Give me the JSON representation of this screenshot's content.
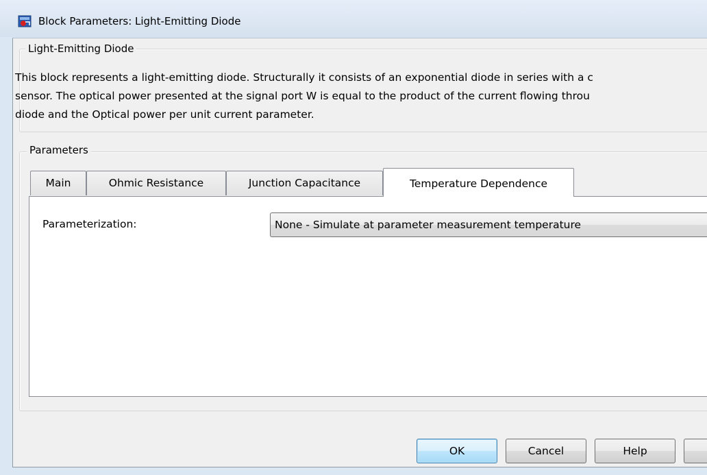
{
  "window": {
    "title": "Block Parameters: Light-Emitting Diode"
  },
  "description": {
    "group_label": "Light-Emitting Diode",
    "lines": [
      "This block represents a light-emitting diode. Structurally it consists of an exponential diode in series with a c",
      "sensor. The optical power presented at the signal port W is equal to the product of the current flowing throu",
      "diode and the Optical power per unit current parameter."
    ]
  },
  "parameters": {
    "group_label": "Parameters",
    "tabs": [
      {
        "label": "Main",
        "active": false
      },
      {
        "label": "Ohmic Resistance",
        "active": false
      },
      {
        "label": "Junction Capacitance",
        "active": false
      },
      {
        "label": "Temperature Dependence",
        "active": true
      }
    ],
    "fields": [
      {
        "label": "Parameterization:",
        "value": "None - Simulate at parameter measurement temperature"
      }
    ]
  },
  "buttons": {
    "ok": "OK",
    "cancel": "Cancel",
    "help": "Help",
    "apply": ""
  },
  "icons": {
    "app": "simulink-block-icon"
  },
  "colors": {
    "title_bar": "#d5e1ef",
    "dialog_bg": "#f0f0f0",
    "default_button_border": "#3c7fb1"
  }
}
